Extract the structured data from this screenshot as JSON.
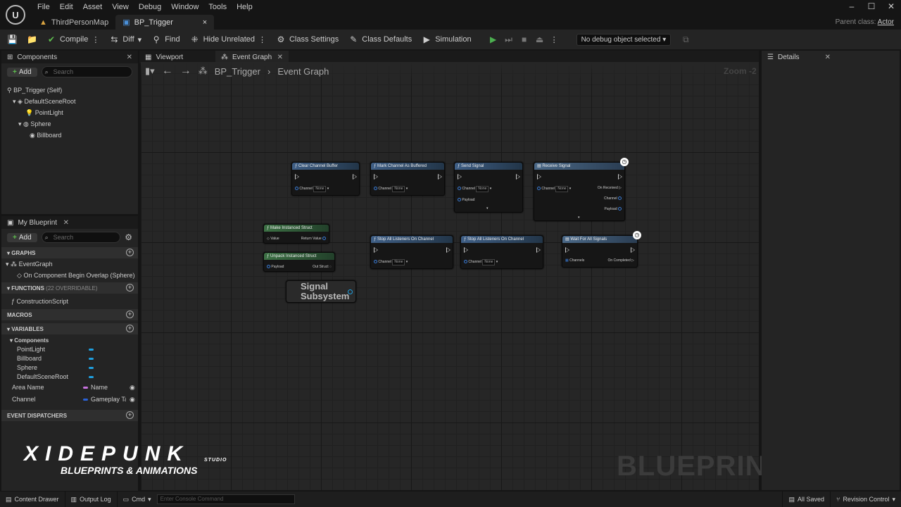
{
  "menu": [
    "File",
    "Edit",
    "Asset",
    "View",
    "Debug",
    "Window",
    "Tools",
    "Help"
  ],
  "window_tabs": [
    {
      "label": "ThirdPersonMap"
    },
    {
      "label": "BP_Trigger",
      "close": "×"
    }
  ],
  "parent_class": {
    "label": "Parent class:",
    "value": "Actor"
  },
  "toolbar": {
    "compile": "Compile",
    "diff": "Diff",
    "find": "Find",
    "hide_unrelated": "Hide Unrelated",
    "class_settings": "Class Settings",
    "class_defaults": "Class Defaults",
    "simulation": "Simulation",
    "debug_object": "No debug object selected"
  },
  "components": {
    "tab": "Components",
    "add": "Add",
    "search_placeholder": "Search",
    "tree": [
      "BP_Trigger (Self)",
      "DefaultSceneRoot",
      "PointLight",
      "Sphere",
      "Billboard"
    ]
  },
  "my_blueprint": {
    "tab": "My Blueprint",
    "add": "Add",
    "search_placeholder": "Search",
    "graphs_header": "GRAPHS",
    "event_graph": "EventGraph",
    "event_item": "On Component Begin Overlap (Sphere)",
    "functions_header": "FUNCTIONS",
    "functions_count": "(22 OVERRIDABLE)",
    "construction": "ConstructionScript",
    "macros_header": "MACROS",
    "variables_header": "VARIABLES",
    "components_group": "Components",
    "component_vars": [
      "PointLight",
      "Billboard",
      "Sphere",
      "DefaultSceneRoot"
    ],
    "vars": [
      {
        "name": "Area Name",
        "type": "Name",
        "color": "#c872e0"
      },
      {
        "name": "Channel",
        "type": "Gameplay Ta",
        "color": "#2a62d8"
      }
    ],
    "dispatchers_header": "EVENT DISPATCHERS"
  },
  "editor_tabs": {
    "viewport": "Viewport",
    "event_graph": "Event Graph"
  },
  "breadcrumb": {
    "bp": "BP_Trigger",
    "graph": "Event Graph",
    "zoom": "Zoom -2"
  },
  "details": {
    "tab": "Details"
  },
  "nodes": {
    "clear": {
      "title": "Clear Channel Buffer",
      "channel": "Channel",
      "none": "None"
    },
    "mark": {
      "title": "Mark Channel As Buffered",
      "channel": "Channel",
      "none": "None"
    },
    "send": {
      "title": "Send Signal",
      "channel": "Channel",
      "none": "None",
      "payload": "Payload"
    },
    "receive": {
      "title": "Receive Signal",
      "channel": "Channel",
      "none": "None",
      "on_received": "On Received",
      "channel_out": "Channel",
      "payload_out": "Payload"
    },
    "make": {
      "title": "Make Instanced Struct",
      "value": "Value",
      "ret": "Return Value"
    },
    "unpack": {
      "title": "Unpack Instanced Struct",
      "payload": "Payload",
      "out": "Out Struct"
    },
    "stop1": {
      "title": "Stop All Listeners On Channel",
      "channel": "Channel",
      "none": "None"
    },
    "stop2": {
      "title": "Stop All Listeners On Channel",
      "channel": "Channel",
      "none": "None"
    },
    "wait": {
      "title": "Wait For All Signals",
      "channels": "Channels",
      "completed": "On Completed"
    },
    "subsystem": {
      "line1": "Signal",
      "line2": "Subsystem"
    }
  },
  "watermark": "BLUEPRINT",
  "brand": {
    "name": "XIDEPUNK",
    "studio": "STUDIO",
    "tagline": "BLUEPRINTS & ANIMATIONS"
  },
  "statusbar": {
    "content_drawer": "Content Drawer",
    "output_log": "Output Log",
    "cmd": "Cmd",
    "console_placeholder": "Enter Console Command",
    "saved": "All Saved",
    "revision": "Revision Control"
  }
}
